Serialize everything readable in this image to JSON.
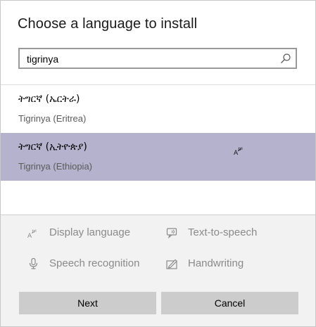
{
  "dialog": {
    "title": "Choose a language to install"
  },
  "search": {
    "value": "tigrinya",
    "icon": "search-icon"
  },
  "results": [
    {
      "native": "ትግርኛ (ኤርትራ)",
      "english": "Tigrinya (Eritrea)",
      "selected": false
    },
    {
      "native": "ትግርኛ (ኢትዮጵያ)",
      "english": "Tigrinya (Ethiopia)",
      "selected": true,
      "feature_icon": "display-language-icon"
    }
  ],
  "features": {
    "display_language": "Display language",
    "text_to_speech": "Text-to-speech",
    "speech_recognition": "Speech recognition",
    "handwriting": "Handwriting"
  },
  "buttons": {
    "next": "Next",
    "cancel": "Cancel"
  },
  "colors": {
    "selected_row": "#b5b2cd",
    "disabled_text": "#8a8a8a",
    "button_bg": "#cccccc",
    "footer_bg": "#f2f2f2"
  }
}
